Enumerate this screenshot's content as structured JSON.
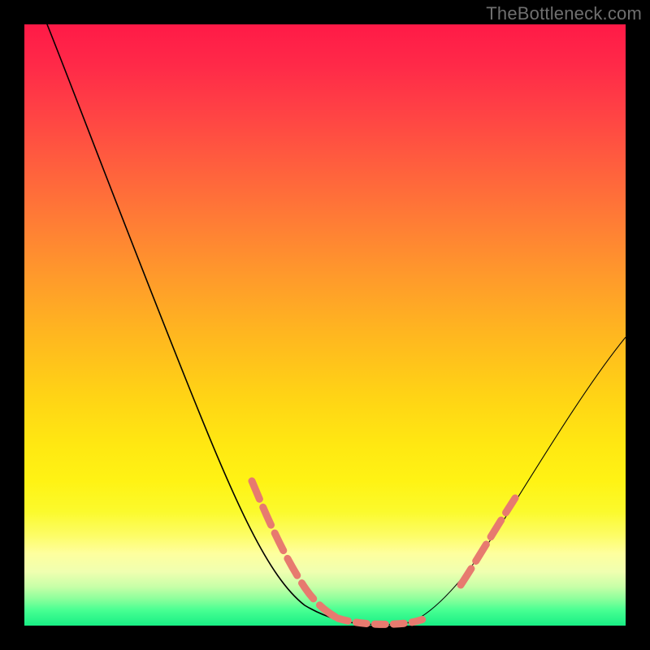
{
  "watermark": "TheBottleneck.com",
  "colors": {
    "background": "#000000",
    "gradient_top": "#ff1a47",
    "gradient_mid": "#ffd415",
    "gradient_bottom": "#18ee84",
    "curve": "#000000",
    "dash": "#e77a6f"
  },
  "chart_data": {
    "type": "line",
    "title": "",
    "xlabel": "",
    "ylabel": "",
    "xlim": [
      0,
      100
    ],
    "ylim": [
      0,
      100
    ],
    "series": [
      {
        "name": "bottleneck-curve",
        "x": [
          4,
          8,
          12,
          16,
          20,
          24,
          28,
          32,
          36,
          40,
          44,
          47,
          50,
          53,
          56,
          59,
          62,
          66,
          70,
          74,
          78,
          82,
          86,
          90,
          94,
          98,
          100
        ],
        "y": [
          100,
          93,
          86,
          79,
          72,
          64,
          56,
          48,
          40,
          31,
          22,
          14,
          7,
          3,
          1,
          0.5,
          0.5,
          1.5,
          4,
          8,
          14,
          21,
          28,
          35,
          41,
          46,
          48
        ]
      }
    ],
    "highlight_segments": [
      {
        "name": "left-descent-dash",
        "x_range": [
          39,
          50
        ],
        "style": "dashed"
      },
      {
        "name": "valley-floor-dash",
        "x_range": [
          50,
          64
        ],
        "style": "dashed-tight"
      },
      {
        "name": "right-ascent-dash",
        "x_range": [
          70,
          81
        ],
        "style": "dashed"
      }
    ]
  }
}
